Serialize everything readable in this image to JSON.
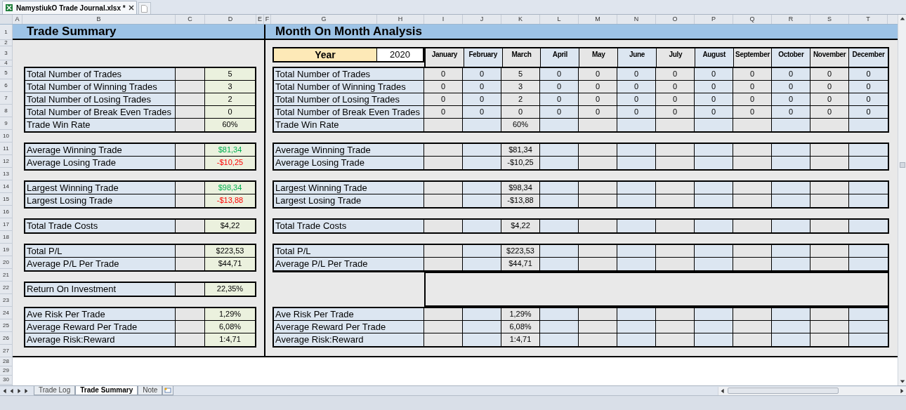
{
  "file_tab": {
    "title": "NamystiukO Trade Journal.xlsx *"
  },
  "column_headers": [
    "A",
    "B",
    "C",
    "D",
    "E",
    "F",
    "G",
    "H",
    "I",
    "J",
    "K",
    "L",
    "M",
    "N",
    "O",
    "P",
    "Q",
    "R",
    "S",
    "T"
  ],
  "row_numbers": [
    "1",
    "2",
    "3",
    "4",
    "5",
    "6",
    "7",
    "8",
    "9",
    "10",
    "11",
    "12",
    "13",
    "14",
    "15",
    "16",
    "17",
    "18",
    "19",
    "20",
    "21",
    "22",
    "23",
    "24",
    "25",
    "26",
    "27",
    "28",
    "29",
    "30"
  ],
  "summary": {
    "title": "Trade Summary",
    "groups": [
      {
        "rows": [
          {
            "label": "Total Number of Trades",
            "value": "5",
            "kind": "plain"
          },
          {
            "label": "Total Number of Winning Trades",
            "value": "3",
            "kind": "plain"
          },
          {
            "label": "Total Number of Losing Trades",
            "value": "2",
            "kind": "plain"
          },
          {
            "label": "Total Number of Break Even Trades",
            "value": "0",
            "kind": "plain"
          },
          {
            "label": "Trade Win Rate",
            "value": "60%",
            "kind": "plain"
          }
        ]
      },
      {
        "rows": [
          {
            "label": "Average Winning Trade",
            "value": "$81,34",
            "kind": "gain"
          },
          {
            "label": "Average Losing Trade",
            "value": "-$10,25",
            "kind": "loss"
          }
        ]
      },
      {
        "rows": [
          {
            "label": "Largest Winning Trade",
            "value": "$98,34",
            "kind": "gain"
          },
          {
            "label": "Largest Losing Trade",
            "value": "-$13,88",
            "kind": "loss"
          }
        ]
      },
      {
        "rows": [
          {
            "label": "Total Trade Costs",
            "value": "$4,22",
            "kind": "plain"
          }
        ]
      },
      {
        "rows": [
          {
            "label": "Total P/L",
            "value": "$223,53",
            "kind": "plain"
          },
          {
            "label": "Average P/L Per Trade",
            "value": "$44,71",
            "kind": "plain"
          }
        ]
      },
      {
        "rows": [
          {
            "label": "Return On Investment",
            "value": "22,35%",
            "kind": "plain"
          }
        ]
      },
      {
        "rows": [
          {
            "label": "Ave Risk Per Trade",
            "value": "1,29%",
            "kind": "plain"
          },
          {
            "label": "Average Reward Per Trade",
            "value": "6,08%",
            "kind": "plain"
          },
          {
            "label": "Average Risk:Reward",
            "value": "1:4,71",
            "kind": "plain"
          }
        ]
      }
    ]
  },
  "monthly": {
    "title": "Month On Month Analysis",
    "year_label": "Year",
    "year": "2020",
    "months": [
      "January",
      "February",
      "March",
      "April",
      "May",
      "June",
      "July",
      "August",
      "September",
      "October",
      "November",
      "December"
    ],
    "groups": [
      {
        "kind": "table",
        "rows": [
          {
            "kind": "all",
            "label": "Total Number of Trades",
            "values": [
              "0",
              "0",
              "5",
              "0",
              "0",
              "0",
              "0",
              "0",
              "0",
              "0",
              "0",
              "0"
            ]
          },
          {
            "kind": "all",
            "label": "Total Number of Winning Trades",
            "values": [
              "0",
              "0",
              "3",
              "0",
              "0",
              "0",
              "0",
              "0",
              "0",
              "0",
              "0",
              "0"
            ]
          },
          {
            "kind": "all",
            "label": "Total Number of Losing Trades",
            "values": [
              "0",
              "0",
              "2",
              "0",
              "0",
              "0",
              "0",
              "0",
              "0",
              "0",
              "0",
              "0"
            ]
          },
          {
            "kind": "all",
            "label": "Total Number of Break Even Trades",
            "values": [
              "0",
              "0",
              "0",
              "0",
              "0",
              "0",
              "0",
              "0",
              "0",
              "0",
              "0",
              "0"
            ]
          },
          {
            "kind": "single",
            "label": "Trade Win Rate",
            "value": "60%"
          }
        ]
      },
      {
        "kind": "table",
        "rows": [
          {
            "kind": "single",
            "label": "Average Winning Trade",
            "value": "$81,34"
          },
          {
            "kind": "single",
            "label": "Average Losing Trade",
            "value": "-$10,25"
          }
        ]
      },
      {
        "kind": "table",
        "rows": [
          {
            "kind": "single",
            "label": "Largest Winning Trade",
            "value": "$98,34"
          },
          {
            "kind": "single",
            "label": "Largest Losing Trade",
            "value": "-$13,88"
          }
        ]
      },
      {
        "kind": "table",
        "rows": [
          {
            "kind": "single",
            "label": "Total Trade Costs",
            "value": "$4,22"
          }
        ]
      },
      {
        "kind": "table",
        "rows": [
          {
            "kind": "single",
            "label": "Total P/L",
            "value": "$223,53"
          },
          {
            "kind": "single",
            "label": "Average P/L Per Trade",
            "value": "$44,71"
          }
        ]
      },
      {
        "kind": "blank"
      },
      {
        "kind": "table",
        "rows": [
          {
            "kind": "single",
            "label": "Ave Risk Per Trade",
            "value": "1,29%"
          },
          {
            "kind": "single",
            "label": "Average Reward Per Trade",
            "value": "6,08%"
          },
          {
            "kind": "single",
            "label": "Average Risk:Reward",
            "value": "1:4,71"
          }
        ]
      }
    ]
  },
  "sheet_tabs": [
    {
      "label": "Trade Log",
      "selected": false
    },
    {
      "label": "Trade Summary",
      "selected": true
    },
    {
      "label": "Note",
      "selected": false
    }
  ]
}
